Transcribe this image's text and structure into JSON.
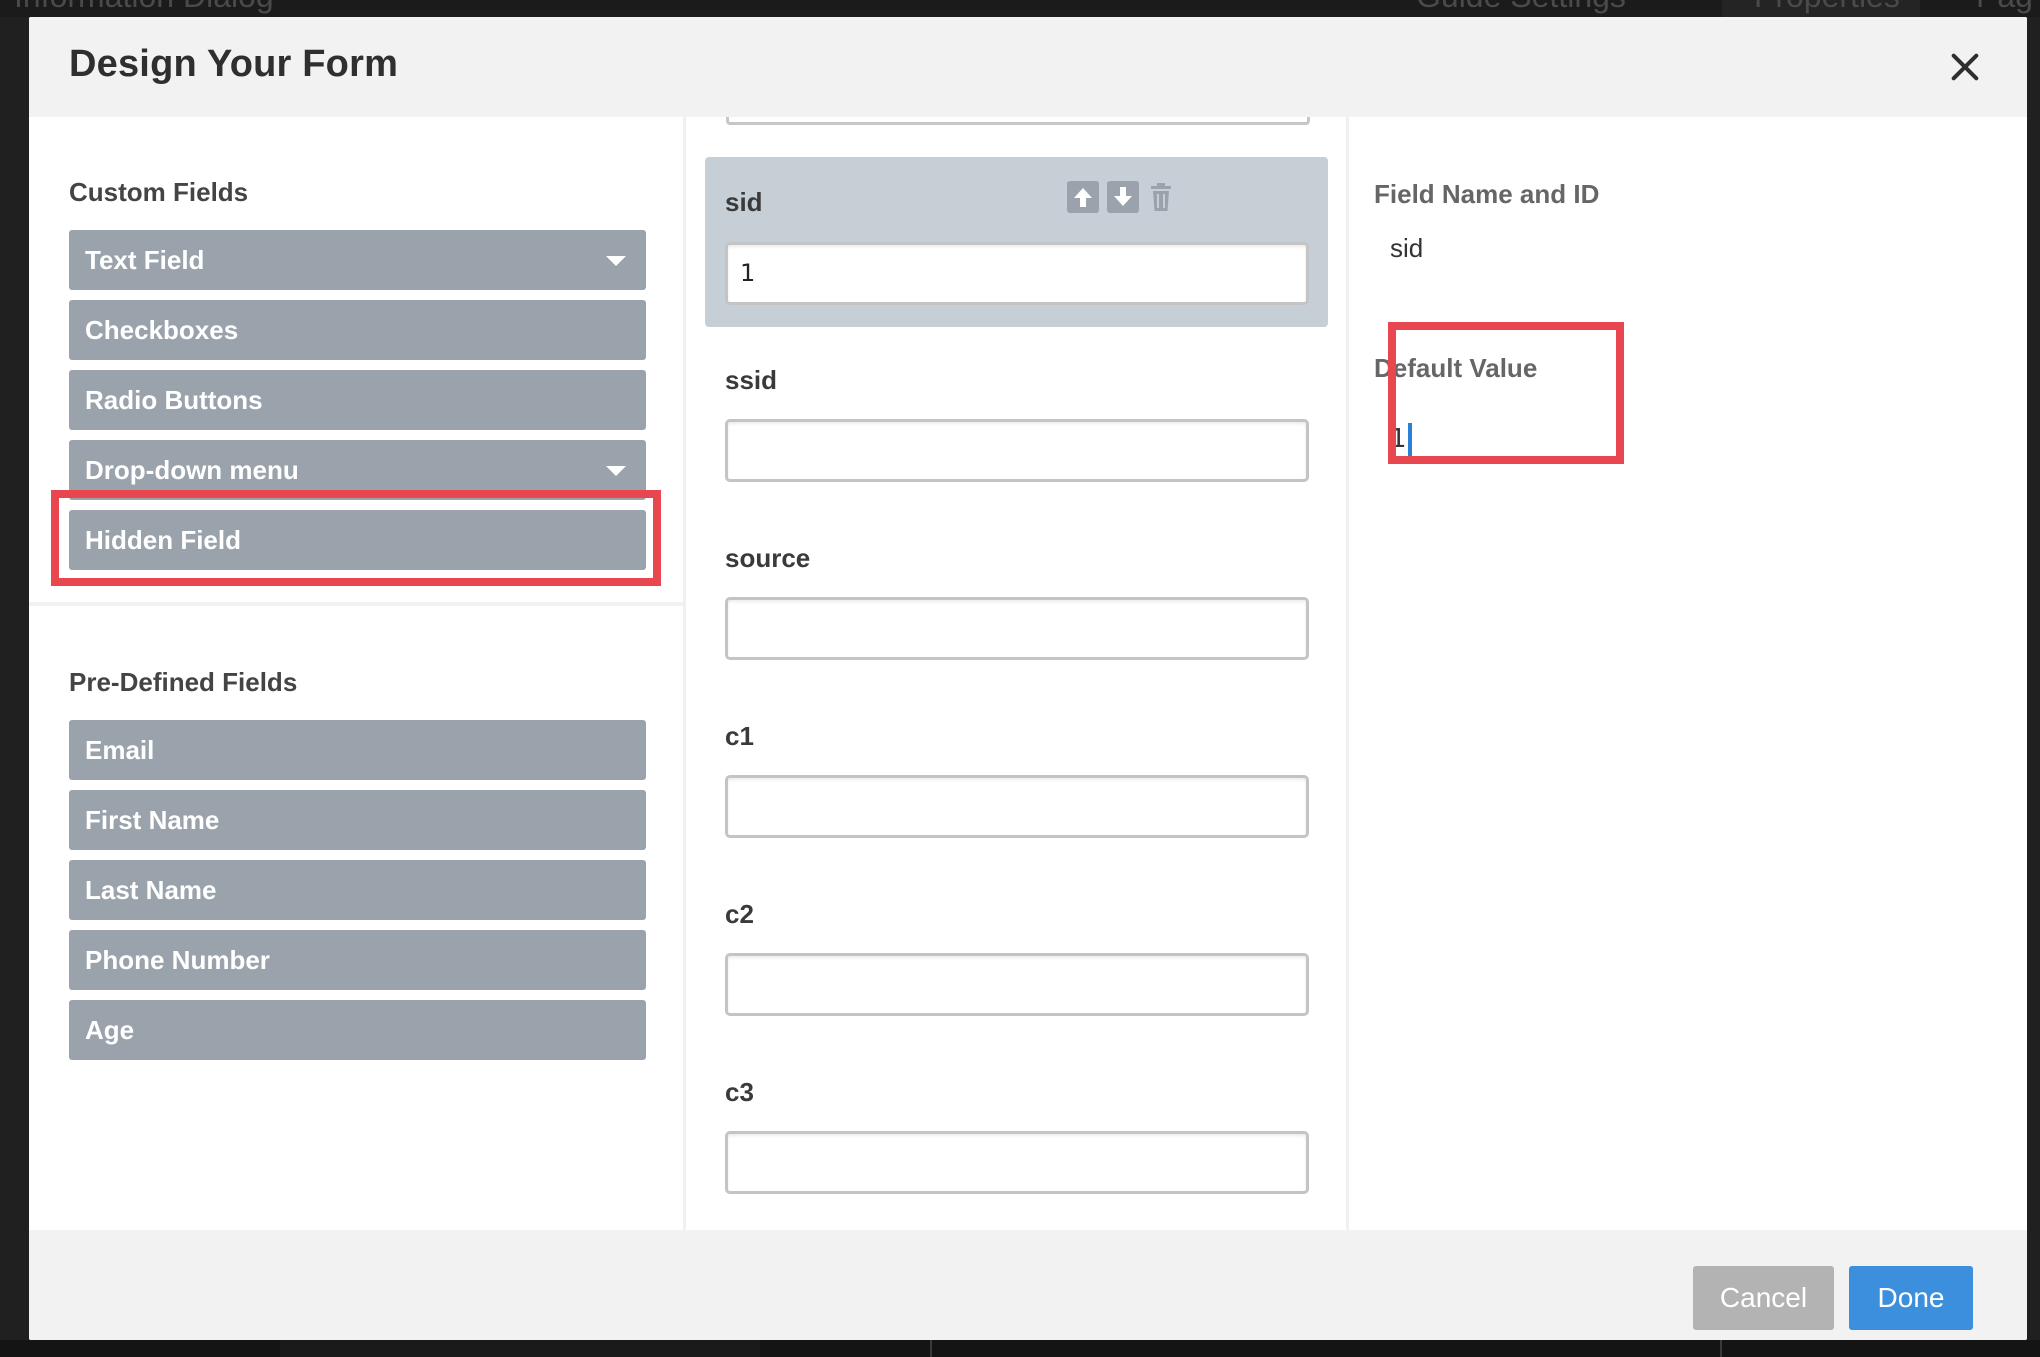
{
  "background": {
    "left_text": "Information Dialog",
    "guide_settings": "Guide Settings",
    "properties": "Properties",
    "right_text": "Pag"
  },
  "modal": {
    "title": "Design Your Form",
    "close_icon": "close-icon"
  },
  "left": {
    "custom_title": "Custom Fields",
    "custom_fields": [
      {
        "label": "Text Field",
        "has_caret": true
      },
      {
        "label": "Checkboxes",
        "has_caret": false
      },
      {
        "label": "Radio Buttons",
        "has_caret": false
      },
      {
        "label": "Drop-down menu",
        "has_caret": true
      },
      {
        "label": "Hidden Field",
        "has_caret": false
      }
    ],
    "predefined_title": "Pre-Defined Fields",
    "predefined_fields": [
      {
        "label": "Email"
      },
      {
        "label": "First Name"
      },
      {
        "label": "Last Name"
      },
      {
        "label": "Phone Number"
      },
      {
        "label": "Age"
      }
    ]
  },
  "middle": {
    "fields": [
      {
        "label": "sid",
        "value": "1",
        "selected": true
      },
      {
        "label": "ssid",
        "value": ""
      },
      {
        "label": "source",
        "value": ""
      },
      {
        "label": "c1",
        "value": ""
      },
      {
        "label": "c2",
        "value": ""
      },
      {
        "label": "c3",
        "value": ""
      }
    ],
    "card_icons": [
      "arrow-up-icon",
      "arrow-down-icon",
      "trash-icon"
    ]
  },
  "right": {
    "name_label": "Field Name and ID",
    "name_value": "sid",
    "default_label": "Default Value",
    "default_value": "1"
  },
  "footer": {
    "cancel_label": "Cancel",
    "done_label": "Done"
  },
  "colors": {
    "highlight": "#e8474f",
    "field_button": "#9aa3ac",
    "selected_card": "#c6ced6",
    "done_button": "#3b8fdc",
    "cancel_button": "#b3b3b3"
  }
}
